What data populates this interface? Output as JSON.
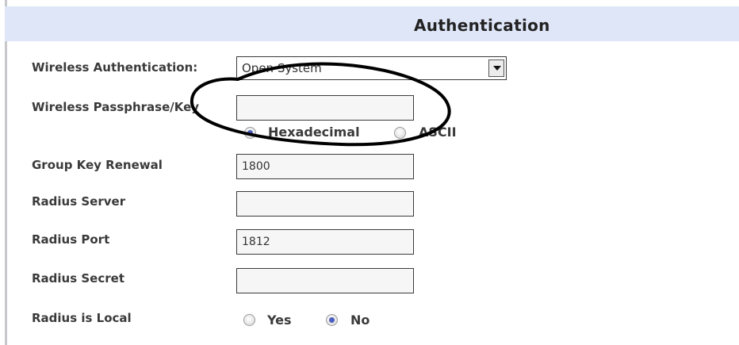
{
  "header": {
    "title": "Authentication"
  },
  "form": {
    "wireless_auth": {
      "label": "Wireless Authentication:",
      "selected": "Open System"
    },
    "passphrase": {
      "label": "Wireless Passphrase/Key",
      "value": "",
      "key_format": {
        "options": [
          "Hexadecimal",
          "ASCII"
        ],
        "selected": "Hexadecimal"
      }
    },
    "group_key_renewal": {
      "label": "Group Key Renewal",
      "value": "1800"
    },
    "radius_server": {
      "label": "Radius Server",
      "value": ""
    },
    "radius_port": {
      "label": "Radius Port",
      "value": "1812"
    },
    "radius_secret": {
      "label": "Radius Secret",
      "value": ""
    },
    "radius_local": {
      "label": "Radius is Local",
      "options": [
        "Yes",
        "No"
      ],
      "selected": "No"
    }
  },
  "colors": {
    "header_bg": "#dfe6f7",
    "radio_dot": "#4b5fbf",
    "annotation": "#000000"
  },
  "icons": {
    "dropdown_arrow": "chevron-down-icon"
  }
}
